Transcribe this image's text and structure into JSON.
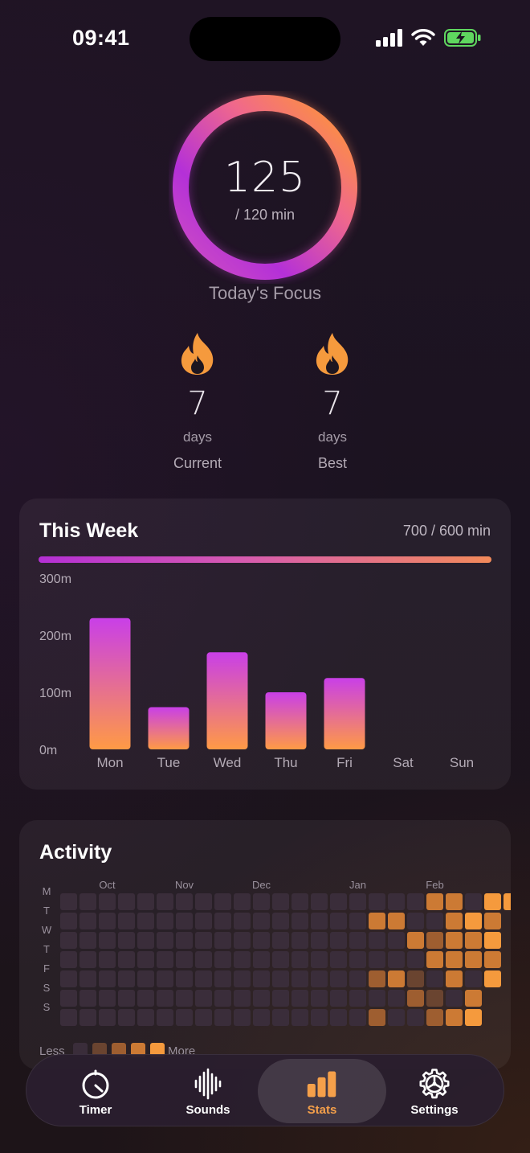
{
  "status": {
    "time": "09:41"
  },
  "focus": {
    "value": "125",
    "goal_text": "/ 120 min",
    "label": "Today's Focus",
    "progress": 1.0
  },
  "streaks": [
    {
      "value": "7",
      "unit": "days",
      "label": "Current",
      "icon": "flame-icon"
    },
    {
      "value": "7",
      "unit": "days",
      "label": "Best",
      "icon": "flame-icon"
    }
  ],
  "week": {
    "title": "This Week",
    "total_text": "700 / 600 min",
    "progress": 1.0,
    "colors": {
      "bar_top": "#c93fe8",
      "bar_bottom": "#ff9a45"
    }
  },
  "chart_data": {
    "type": "bar",
    "categories": [
      "Mon",
      "Tue",
      "Wed",
      "Thu",
      "Fri",
      "Sat",
      "Sun"
    ],
    "values": [
      230,
      74,
      170,
      100,
      125,
      0,
      0
    ],
    "ylim": [
      0,
      300
    ],
    "yticks": [
      0,
      100,
      200,
      300
    ],
    "ytick_labels": [
      "0m",
      "100m",
      "200m",
      "300m"
    ],
    "grid": false
  },
  "activity": {
    "title": "Activity",
    "months": [
      "Oct",
      "Nov",
      "Dec",
      "Jan",
      "Feb"
    ],
    "month_columns": [
      2,
      6,
      10,
      15,
      19
    ],
    "day_labels": [
      "M",
      "T",
      "W",
      "T",
      "F",
      "S",
      "S"
    ],
    "legend_less": "Less",
    "legend_more": "More",
    "level_colors": [
      "#3a2d3a",
      "#6a4430",
      "#9e5e30",
      "#cc7a34",
      "#f59a3d"
    ],
    "levels": [
      [
        0,
        0,
        0,
        0,
        0,
        0,
        0,
        0,
        0,
        0,
        0,
        0,
        0,
        0,
        0,
        0,
        0,
        0,
        0,
        3,
        3,
        0,
        4,
        4
      ],
      [
        0,
        0,
        0,
        0,
        0,
        0,
        0,
        0,
        0,
        0,
        0,
        0,
        0,
        0,
        0,
        0,
        3,
        3,
        0,
        0,
        3,
        4,
        3
      ],
      [
        0,
        0,
        0,
        0,
        0,
        0,
        0,
        0,
        0,
        0,
        0,
        0,
        0,
        0,
        0,
        0,
        0,
        0,
        3,
        2,
        3,
        3,
        4
      ],
      [
        0,
        0,
        0,
        0,
        0,
        0,
        0,
        0,
        0,
        0,
        0,
        0,
        0,
        0,
        0,
        0,
        0,
        0,
        0,
        3,
        3,
        3,
        3
      ],
      [
        0,
        0,
        0,
        0,
        0,
        0,
        0,
        0,
        0,
        0,
        0,
        0,
        0,
        0,
        0,
        0,
        2,
        3,
        1,
        0,
        3,
        0,
        4
      ],
      [
        0,
        0,
        0,
        0,
        0,
        0,
        0,
        0,
        0,
        0,
        0,
        0,
        0,
        0,
        0,
        0,
        0,
        0,
        2,
        1,
        0,
        3
      ],
      [
        0,
        0,
        0,
        0,
        0,
        0,
        0,
        0,
        0,
        0,
        0,
        0,
        0,
        0,
        0,
        0,
        2,
        0,
        0,
        2,
        3,
        4
      ]
    ]
  },
  "tabs": [
    {
      "label": "Timer",
      "icon": "timer-icon",
      "active": false
    },
    {
      "label": "Sounds",
      "icon": "waveform-icon",
      "active": false
    },
    {
      "label": "Stats",
      "icon": "bar-chart-icon",
      "active": true
    },
    {
      "label": "Settings",
      "icon": "gear-icon",
      "active": false
    }
  ]
}
